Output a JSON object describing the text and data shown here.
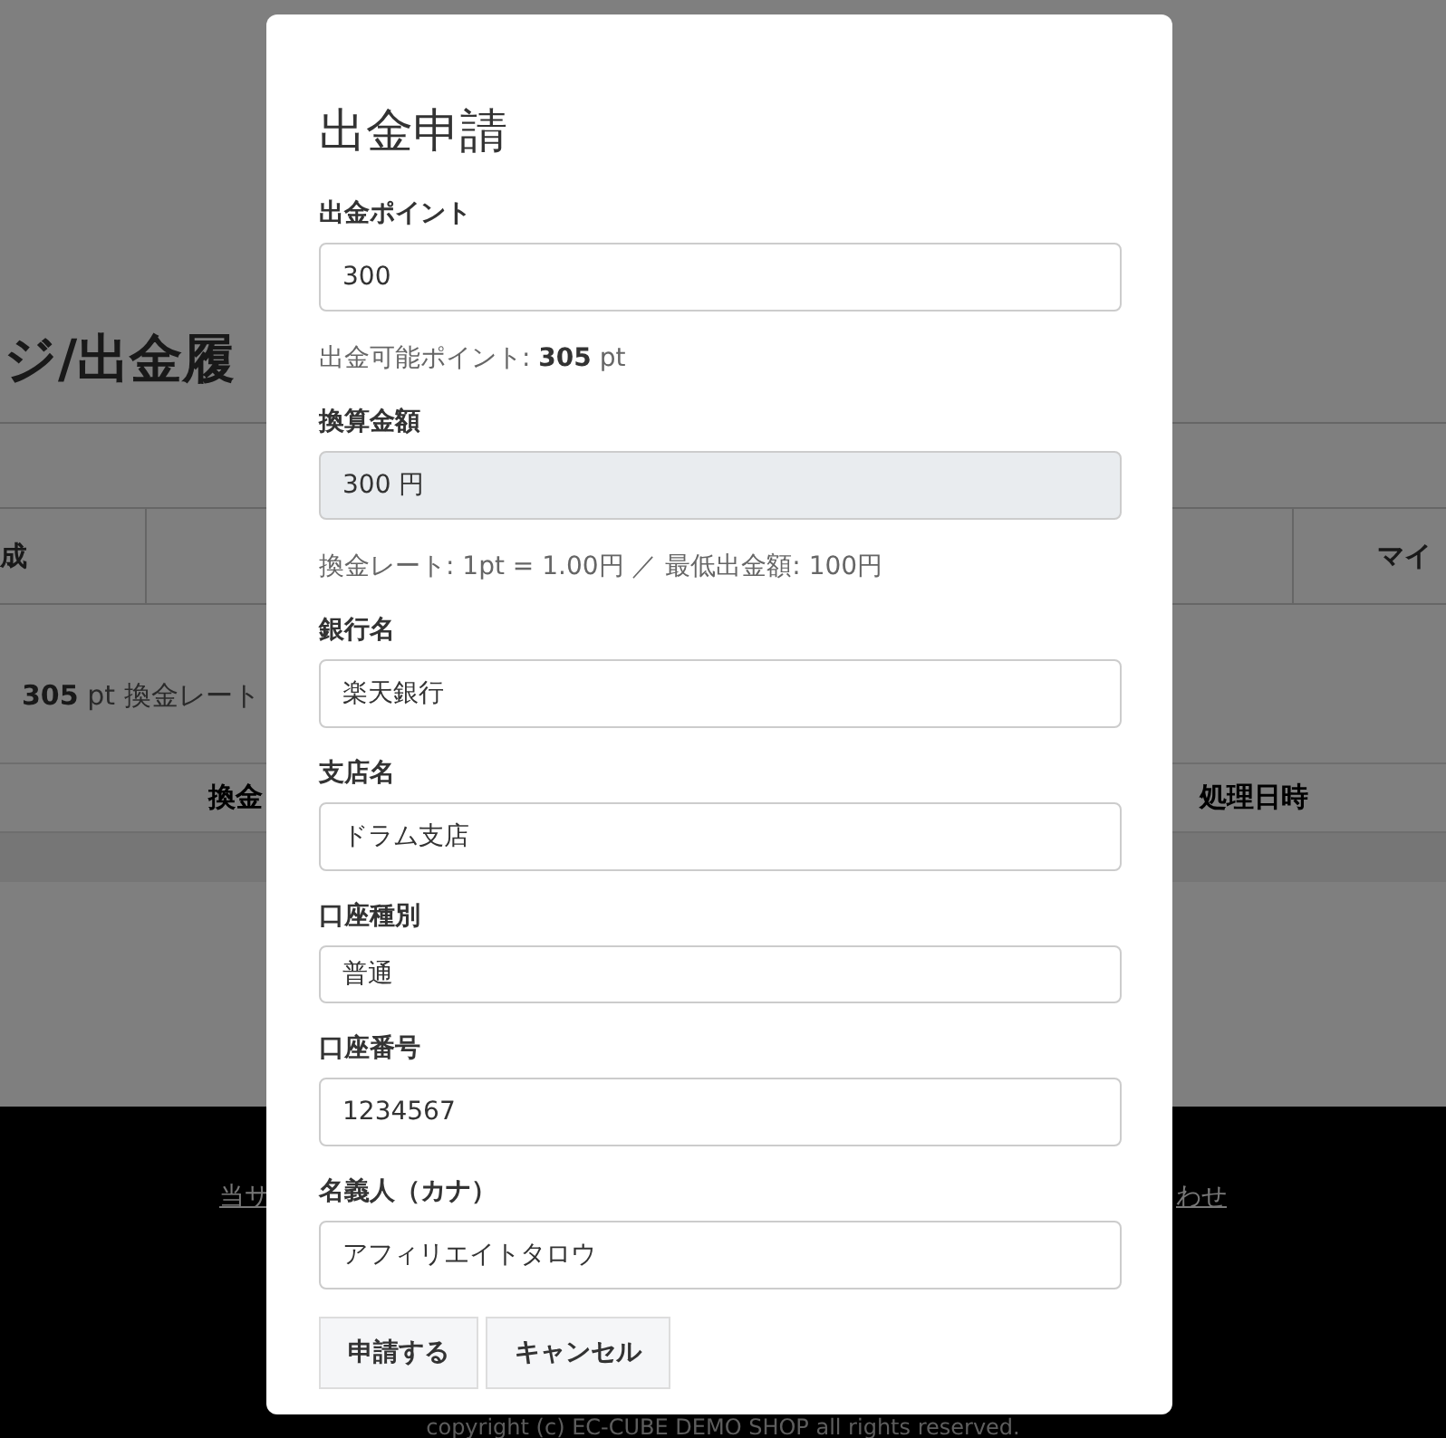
{
  "background": {
    "page_title": "ジ/出金履",
    "nav_items": [
      {
        "label": "成"
      },
      {
        "label": "マイ"
      }
    ],
    "points_summary": "**305** pt 換金レート",
    "table_columns": [
      "換金",
      "処理日時"
    ],
    "footer_links": [
      "当サ",
      "わせ"
    ],
    "copyright": "copyright (c) EC-CUBE DEMO SHOP all rights reserved."
  },
  "dialog": {
    "title": "出金申請",
    "fields": [
      {
        "label": "出金ポイント",
        "value": "300",
        "kind": "text",
        "hint": "出金可能ポイント: **305** pt"
      },
      {
        "label": "換算金額",
        "value": "300 円",
        "kind": "readonly",
        "hint": "換金レート: 1pt = 1.00円 ／ 最低出金額: 100円"
      },
      {
        "label": "銀行名",
        "value": "楽天銀行",
        "kind": "text"
      },
      {
        "label": "支店名",
        "value": "ドラム支店",
        "kind": "text"
      },
      {
        "label": "口座種別",
        "value": "普通",
        "kind": "compact"
      },
      {
        "label": "口座番号",
        "value": "1234567",
        "kind": "text"
      },
      {
        "label": "名義人（カナ）",
        "value": "アフィリエイトタロウ",
        "kind": "text"
      }
    ],
    "buttons": [
      "申請する",
      "キャンセル"
    ]
  }
}
